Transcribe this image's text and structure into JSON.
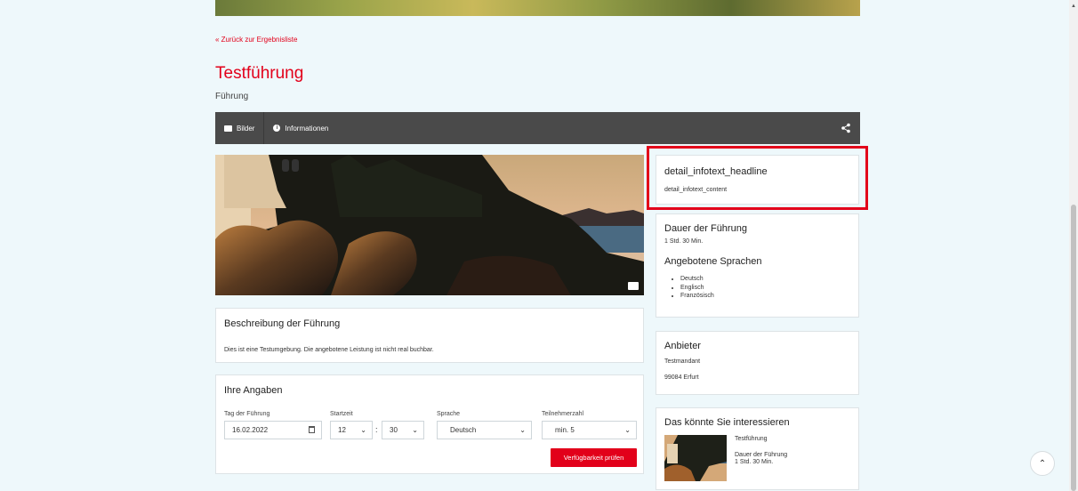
{
  "nav": {
    "back_link": "« Zurück zur Ergebnisliste"
  },
  "header": {
    "title": "Testführung",
    "subtitle": "Führung"
  },
  "tabs": [
    {
      "label": "Bilder",
      "icon": "image-icon"
    },
    {
      "label": "Informationen",
      "icon": "info-icon"
    }
  ],
  "share_icon": "share-icon",
  "description": {
    "heading": "Beschreibung der Führung",
    "text": "Dies ist eine Testumgebung. Die angebotene Leistung ist nicht real buchbar."
  },
  "form": {
    "heading": "Ihre Angaben",
    "date_label": "Tag der Führung",
    "date_value": "16.02.2022",
    "start_label": "Startzeit",
    "hour_value": "12",
    "minute_value": "30",
    "time_separator": ":",
    "language_label": "Sprache",
    "language_value": "Deutsch",
    "participants_label": "Teilnehmerzahl",
    "participants_value": "min. 5",
    "submit_label": "Verfügbarkeit prüfen"
  },
  "info_box": {
    "headline": "detail_infotext_headline",
    "content": "detail_infotext_content"
  },
  "details": {
    "duration_heading": "Dauer der Führung",
    "duration_value": "1 Std. 30 Min.",
    "languages_heading": "Angebotene Sprachen",
    "languages": [
      "Deutsch",
      "Englisch",
      "Französisch"
    ]
  },
  "provider": {
    "heading": "Anbieter",
    "name": "Testmandant",
    "city": "99084 Erfurt"
  },
  "recommendations": {
    "heading": "Das könnte Sie interessieren",
    "item_title": "Testführung",
    "item_duration_label": "Dauer der Führung",
    "item_duration_value": "1 Std. 30 Min."
  },
  "colors": {
    "accent": "#e2001a",
    "tabbar": "#4a4a4a",
    "background": "#eef8fb"
  }
}
